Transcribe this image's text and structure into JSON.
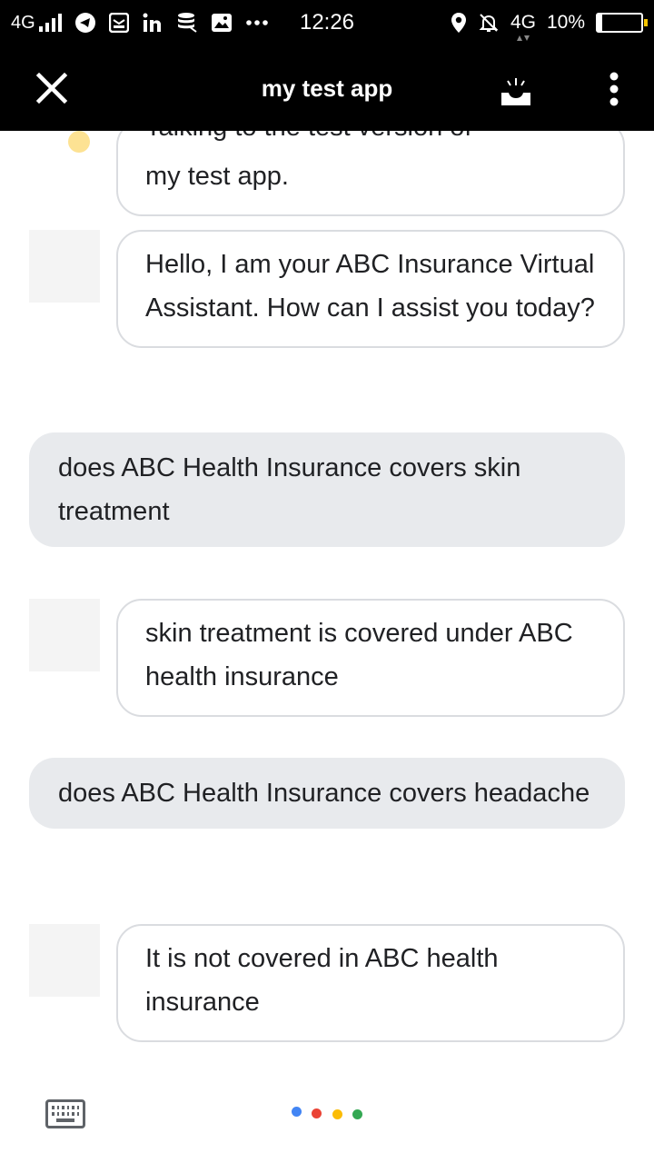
{
  "status_bar": {
    "network_left": "4G",
    "time": "12:26",
    "network_right": "4G",
    "battery": "10%",
    "battery_level": 0.1,
    "notification_icons": [
      "telegram-icon",
      "mail-icon",
      "linkedin-icon",
      "data-saver-icon",
      "gallery-icon",
      "more-dots-icon"
    ]
  },
  "top_bar": {
    "title": "my test app"
  },
  "conversation": {
    "truncated_message_tail": "my test app.",
    "messages": [
      {
        "role": "assistant",
        "text": "Hello, I am your ABC Insurance Virtual Assistant. How can I assist you today?"
      },
      {
        "role": "user",
        "text": "does ABC Health Insurance covers skin treatment"
      },
      {
        "role": "assistant",
        "text": "skin treatment is covered under ABC health insurance"
      },
      {
        "role": "user",
        "text": "does ABC Health Insurance covers headache"
      },
      {
        "role": "assistant",
        "text": "It is not covered in ABC health insurance"
      }
    ]
  },
  "colors": {
    "bar_background": "#000000",
    "user_bubble": "#e8eaed",
    "bot_bubble_border": "#dadce0",
    "google_dots": [
      "#4285f4",
      "#ea4335",
      "#fbbc05",
      "#34a853"
    ]
  }
}
